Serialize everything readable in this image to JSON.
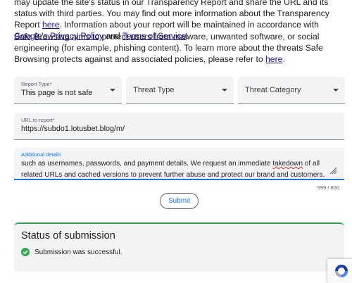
{
  "intro": {
    "line1": "may update the site's status in our Transparency Report and share the URL and its status with third parties. You may find out more information about the Transparency Report ",
    "link_here": "here",
    "line2": ". Information about your report will be maintained in accordance with ",
    "link_privacy": "Google's Privacy Policy",
    "and": " and ",
    "link_terms": "Terms of Service",
    "end": "."
  },
  "safe_browsing": {
    "text": "Safe Browsing aims to protect users from malware, unwanted software, or social engineering (for example, phishing content). To learn more about the threats Safe Browsing protects against and associated policies, please refer to ",
    "link_here": "here",
    "end": "."
  },
  "form": {
    "report_type": {
      "label": "Report Type*",
      "value": "This page is not safe"
    },
    "threat_type": {
      "placeholder": "Threat Type"
    },
    "threat_category": {
      "placeholder": "Threat Category"
    },
    "url": {
      "label": "URL to report*",
      "value": "https://subdo1.lotusbet.blog/m/"
    },
    "details": {
      "label": "Additional details",
      "text_a": "such as usernames, passwords, and payment details. We request an immediate ",
      "text_squiggle": "takedown",
      "text_b": " of all related URLs and cached versions to prevent further abuse and protect our brand and customers.",
      "counter": "599 / 800"
    },
    "submit_label": "Submit"
  },
  "status": {
    "title": "Status of submission",
    "message": "Submission was successful.",
    "success_color": "#34a853"
  },
  "icons": {
    "dropdown": "triangle-down-icon",
    "check": "check-circle-icon",
    "resize": "resize-handle-icon",
    "recaptcha": "recaptcha-logo-icon"
  }
}
